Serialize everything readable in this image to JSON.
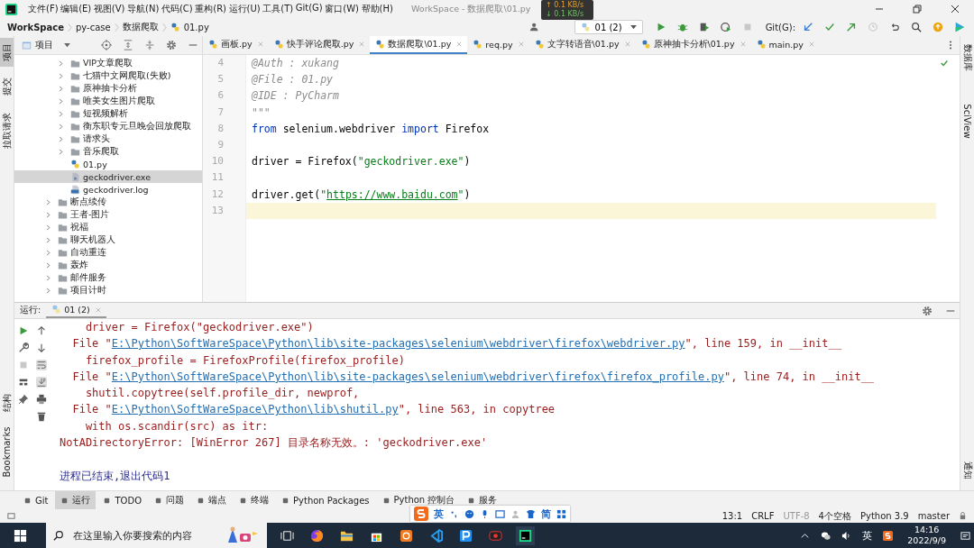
{
  "window": {
    "title": "WorkSpace - 数据爬取\\01.py"
  },
  "menu": [
    "文件(F)",
    "编辑(E)",
    "视图(V)",
    "导航(N)",
    "代码(C)",
    "重构(R)",
    "运行(U)",
    "工具(T)",
    "Git(G)",
    "窗口(W)",
    "帮助(H)"
  ],
  "network": {
    "upload": "↑ 0.1 KB/s",
    "download": "↓ 0.1 KB/s"
  },
  "breadcrumbs": [
    "WorkSpace",
    "py-case",
    "数据爬取",
    "01.py"
  ],
  "run_config": "01 (2)",
  "git_label": "Git(G):",
  "left_strip": [
    {
      "label": "项目",
      "selected": true
    },
    {
      "label": "提交",
      "selected": false
    },
    {
      "label": "拉取请求",
      "selected": false
    }
  ],
  "left_strip_bottom": [
    "结构",
    "Bookmarks"
  ],
  "right_strip": [
    "数据库",
    "SciView"
  ],
  "right_strip_bottom": "通知",
  "project_panel": {
    "title": "项目"
  },
  "tree": [
    {
      "children": [
        {
          "kind": "folder",
          "label": "VIP文章爬取",
          "expanded": false,
          "selected": false
        },
        {
          "kind": "folder",
          "label": "七猫中文网爬取(失败)",
          "expanded": false,
          "selected": false
        },
        {
          "kind": "folder",
          "label": "原神抽卡分析",
          "expanded": false,
          "selected": false
        },
        {
          "kind": "folder",
          "label": "唯美女生图片爬取",
          "expanded": false,
          "selected": false
        },
        {
          "kind": "folder",
          "label": "短视频解析",
          "expanded": false,
          "selected": false
        },
        {
          "kind": "folder",
          "label": "衡东职专元旦晚会回放爬取",
          "expanded": false,
          "selected": false
        },
        {
          "kind": "folder",
          "label": "请求头",
          "expanded": false,
          "selected": false
        },
        {
          "kind": "folder",
          "label": "音乐爬取",
          "expanded": false,
          "selected": false
        },
        {
          "kind": "python",
          "label": "01.py",
          "selected": false
        },
        {
          "kind": "exe",
          "label": "geckodriver.exe",
          "selected": true
        },
        {
          "kind": "log",
          "label": "geckodriver.log",
          "selected": false
        }
      ]
    },
    {
      "kind": "folder",
      "label": "断点续传",
      "expanded": false,
      "selected": false
    },
    {
      "kind": "folder",
      "label": "王者-图片",
      "expanded": false,
      "selected": false
    },
    {
      "kind": "folder",
      "label": "祝福",
      "expanded": false,
      "selected": false
    },
    {
      "kind": "folder",
      "label": "聊天机器人",
      "expanded": false,
      "selected": false
    },
    {
      "kind": "folder",
      "label": "自动重连",
      "expanded": false,
      "selected": false
    },
    {
      "kind": "folder",
      "label": "轰炸",
      "expanded": false,
      "selected": false
    },
    {
      "kind": "folder",
      "label": "邮件服务",
      "expanded": false,
      "selected": false
    },
    {
      "kind": "folder",
      "label": "项目计时",
      "expanded": false,
      "selected": false
    }
  ],
  "editor_tabs": [
    {
      "label": "画板.py",
      "selected": false
    },
    {
      "label": "快手评论爬取.py",
      "selected": false
    },
    {
      "label": "数据爬取\\01.py",
      "selected": true
    },
    {
      "label": "req.py",
      "selected": false
    },
    {
      "label": "文字转语音\\01.py",
      "selected": false
    },
    {
      "label": "原神抽卡分析\\01.py",
      "selected": false
    },
    {
      "label": "main.py",
      "selected": false
    }
  ],
  "code": [
    {
      "number": "4",
      "current": false,
      "segments": [
        {
          "kind": "comment",
          "text": "@Auth : xukang"
        }
      ]
    },
    {
      "number": "5",
      "current": false,
      "segments": [
        {
          "kind": "comment",
          "text": "@File : 01.py"
        }
      ]
    },
    {
      "number": "6",
      "current": false,
      "segments": [
        {
          "kind": "comment",
          "text": "@IDE : PyCharm"
        }
      ]
    },
    {
      "number": "7",
      "current": false,
      "segments": [
        {
          "kind": "comment",
          "text": "\"\"\""
        }
      ]
    },
    {
      "number": "8",
      "current": false,
      "segments": [
        {
          "kind": "keyword",
          "text": "from"
        },
        {
          "kind": "plain",
          "text": " selenium.webdriver "
        },
        {
          "kind": "keyword",
          "text": "import"
        },
        {
          "kind": "plain",
          "text": " Firefox"
        }
      ]
    },
    {
      "number": "9",
      "current": false
    },
    {
      "number": "10",
      "current": false,
      "segments": [
        {
          "kind": "plain",
          "text": "driver = Firefox("
        },
        {
          "kind": "string",
          "text": "\"geckodriver.exe\""
        },
        {
          "kind": "plain",
          "text": ")"
        }
      ]
    },
    {
      "number": "11",
      "current": false
    },
    {
      "number": "12",
      "current": false,
      "segments": [
        {
          "kind": "plain",
          "text": "driver.get("
        },
        {
          "kind": "string",
          "text": "\""
        },
        {
          "kind": "link",
          "text": "https://www.baidu.com"
        },
        {
          "kind": "string",
          "text": "\""
        },
        {
          "kind": "plain",
          "text": ")"
        }
      ]
    },
    {
      "number": "13",
      "current": true
    }
  ],
  "run_panel": {
    "label": "运行:",
    "tab": "01 (2)"
  },
  "console": [
    {
      "segments": [
        {
          "kind": "error",
          "text": "    driver = Firefox(\"geckodriver.exe\")"
        }
      ]
    },
    {
      "segments": [
        {
          "kind": "error",
          "text": "  File \""
        },
        {
          "kind": "link",
          "text": "E:\\Python\\SoftWareSpace\\Python\\lib\\site-packages\\selenium\\webdriver\\firefox\\webdriver.py"
        },
        {
          "kind": "error",
          "text": "\", line 159, in __init__"
        }
      ]
    },
    {
      "segments": [
        {
          "kind": "error",
          "text": "    firefox_profile = FirefoxProfile(firefox_profile)"
        }
      ]
    },
    {
      "segments": [
        {
          "kind": "error",
          "text": "  File \""
        },
        {
          "kind": "link",
          "text": "E:\\Python\\SoftWareSpace\\Python\\lib\\site-packages\\selenium\\webdriver\\firefox\\firefox_profile.py"
        },
        {
          "kind": "error",
          "text": "\", line 74, in __init__"
        }
      ]
    },
    {
      "segments": [
        {
          "kind": "error",
          "text": "    shutil.copytree(self.profile_dir, newprof,"
        }
      ]
    },
    {
      "segments": [
        {
          "kind": "error",
          "text": "  File \""
        },
        {
          "kind": "link",
          "text": "E:\\Python\\SoftWareSpace\\Python\\lib\\shutil.py"
        },
        {
          "kind": "error",
          "text": "\", line 563, in copytree"
        }
      ]
    },
    {
      "segments": [
        {
          "kind": "error",
          "text": "    with os.scandir(src) as itr:"
        }
      ]
    },
    {
      "segments": [
        {
          "kind": "error",
          "text": "NotADirectoryError: [WinError 267] 目录名称无效。: 'geckodriver.exe'"
        }
      ]
    }
  ],
  "exit_message": "进程已结束,退出代码1",
  "tool_tabs": [
    {
      "label": "Git",
      "selected": false
    },
    {
      "label": "运行",
      "selected": true
    },
    {
      "label": "TODO",
      "selected": false
    },
    {
      "label": "问题",
      "selected": false
    },
    {
      "label": "端点",
      "selected": false
    },
    {
      "label": "终端",
      "selected": false
    },
    {
      "label": "Python Packages",
      "selected": false
    },
    {
      "label": "Python 控制台",
      "selected": false
    },
    {
      "label": "服务",
      "selected": false
    }
  ],
  "status_bar": [
    "13:1",
    "CRLF",
    "UTF-8",
    "4个空格",
    "Python 3.9",
    "master"
  ],
  "ime": {
    "mode": "英",
    "script": "简"
  },
  "taskbar": {
    "search_placeholder": "在这里输入你要搜索的内容",
    "tray_language": "英",
    "time": "14:16",
    "date": "2022/9/9"
  }
}
